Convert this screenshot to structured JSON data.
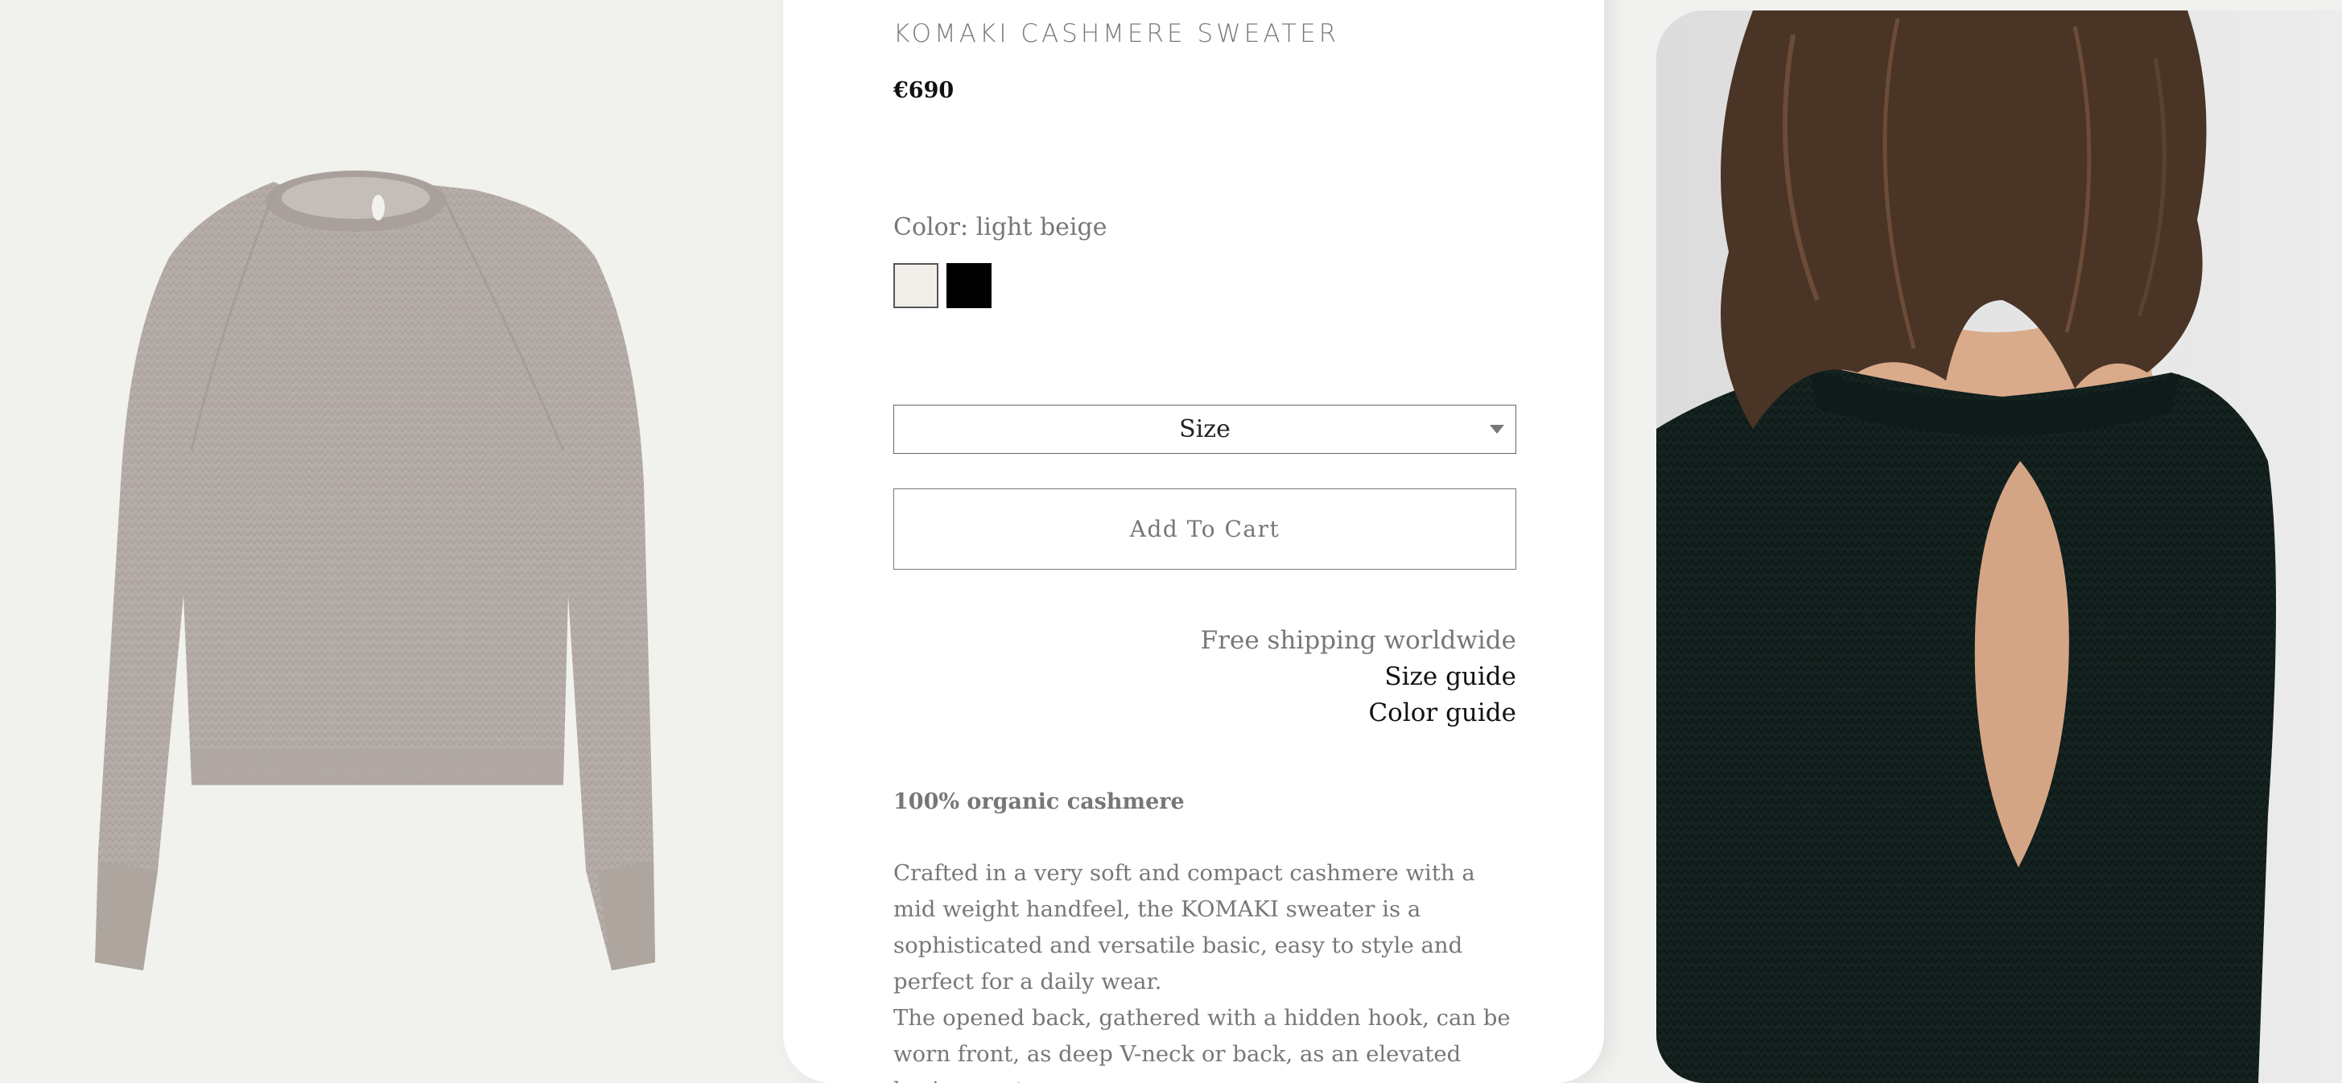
{
  "product": {
    "title": "KOMAKI CASHMERE SWEATER",
    "price": "€690",
    "color_label": "Color: light beige",
    "swatches": [
      {
        "name": "light beige",
        "hex": "#f1eeea",
        "selected": true
      },
      {
        "name": "black",
        "hex": "#000000",
        "selected": false
      }
    ],
    "size_select": {
      "label": "Size"
    },
    "add_to_cart_label": "Add To Cart",
    "shipping_text": "Free shipping worldwide",
    "size_guide_label": "Size guide",
    "color_guide_label": "Color guide",
    "composition": "100% organic cashmere",
    "description": [
      "Crafted in a very soft and compact cashmere with a mid weight handfeel, the KOMAKI sweater is a sophisticated and versatile basic, easy to style and perfect for a daily wear.",
      "The opened back, gathered with a hidden hook, can be worn front, as deep V-neck or back, as an elevated basic sweater"
    ]
  },
  "images": {
    "left": {
      "subject": "light beige cashmere sweater",
      "background": "#f1f1ee",
      "garment_color": "#b6ada8"
    },
    "right": {
      "subject": "model wearing black sweater with open back",
      "background": "#e4e4e4",
      "garment_color": "#142220"
    }
  },
  "colors": {
    "card_background": "#ffffff",
    "muted_text": "#777777",
    "dark_text": "#111111",
    "border": "#666666"
  }
}
